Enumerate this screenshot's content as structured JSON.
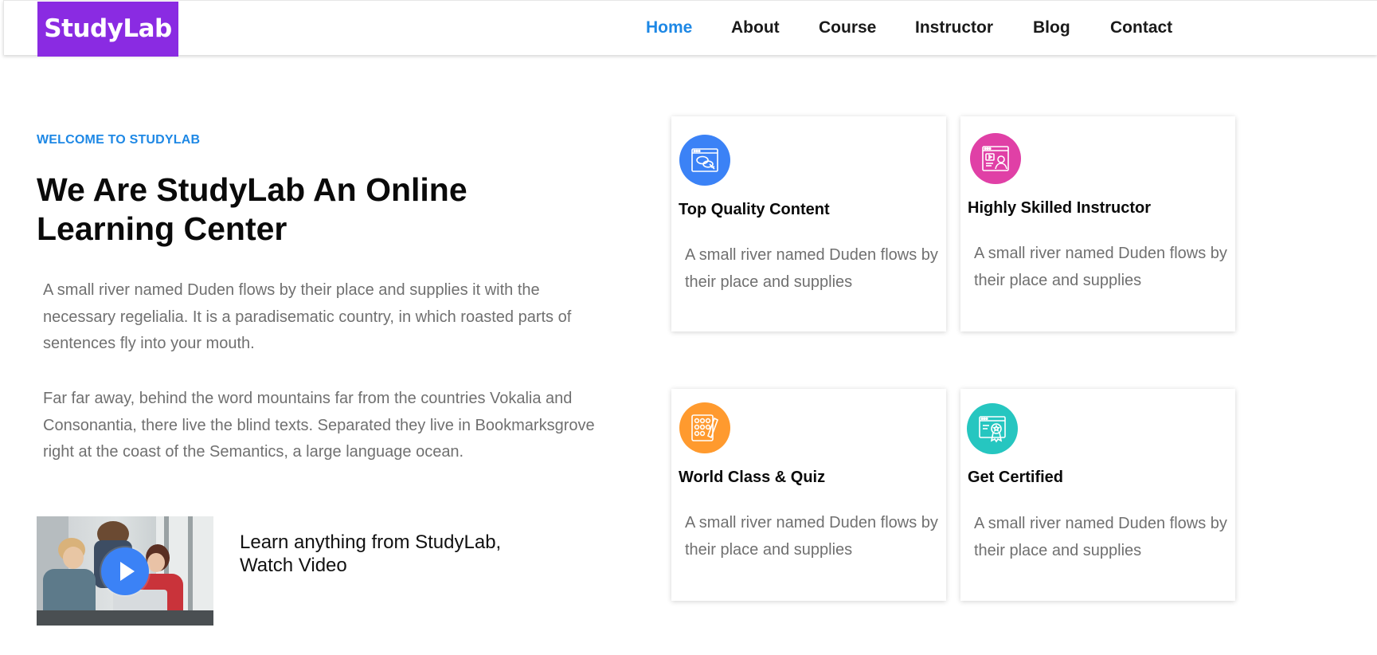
{
  "brand": {
    "logo_text": "StudyLab",
    "logo_color": "#8a2be2",
    "accent_color": "#1e88e5"
  },
  "nav": {
    "items": [
      {
        "label": "Home",
        "active": true
      },
      {
        "label": "About",
        "active": false
      },
      {
        "label": "Course",
        "active": false
      },
      {
        "label": "Instructor",
        "active": false
      },
      {
        "label": "Blog",
        "active": false
      },
      {
        "label": "Contact",
        "active": false
      }
    ]
  },
  "hero": {
    "eyebrow": "WELCOME TO STUDYLAB",
    "title": "We Are StudyLab An Online Learning Center",
    "paragraphs": [
      "A small river named Duden flows by their place and supplies it with the necessary regelialia. It is a paradisematic country, in which roasted parts of sentences fly into your mouth.",
      "Far far away, behind the word mountains far from the countries Vokalia and Consonantia, there live the blind texts. Separated they live in Bookmarksgrove right at the coast of the Semantics, a large language ocean."
    ],
    "video": {
      "icon": "play-icon",
      "caption_line1": "Learn anything from StudyLab,",
      "caption_line2": "Watch Video"
    }
  },
  "features": [
    {
      "title": "Top Quality Content",
      "text": "A small river named Duden flows by their place and supplies",
      "icon": "content-browser-icon",
      "color": "#3b82f6"
    },
    {
      "title": "Highly Skilled Instructor",
      "text": "A small river named Duden flows by their place and supplies",
      "icon": "instructor-icon",
      "color": "#e040a6"
    },
    {
      "title": "World Class & Quiz",
      "text": "A small river named Duden flows by their place and supplies",
      "icon": "quiz-icon",
      "color": "#ff9a2e"
    },
    {
      "title": "Get Certified",
      "text": "A small river named Duden flows by their place and supplies",
      "icon": "certificate-icon",
      "color": "#26c6c0"
    }
  ]
}
